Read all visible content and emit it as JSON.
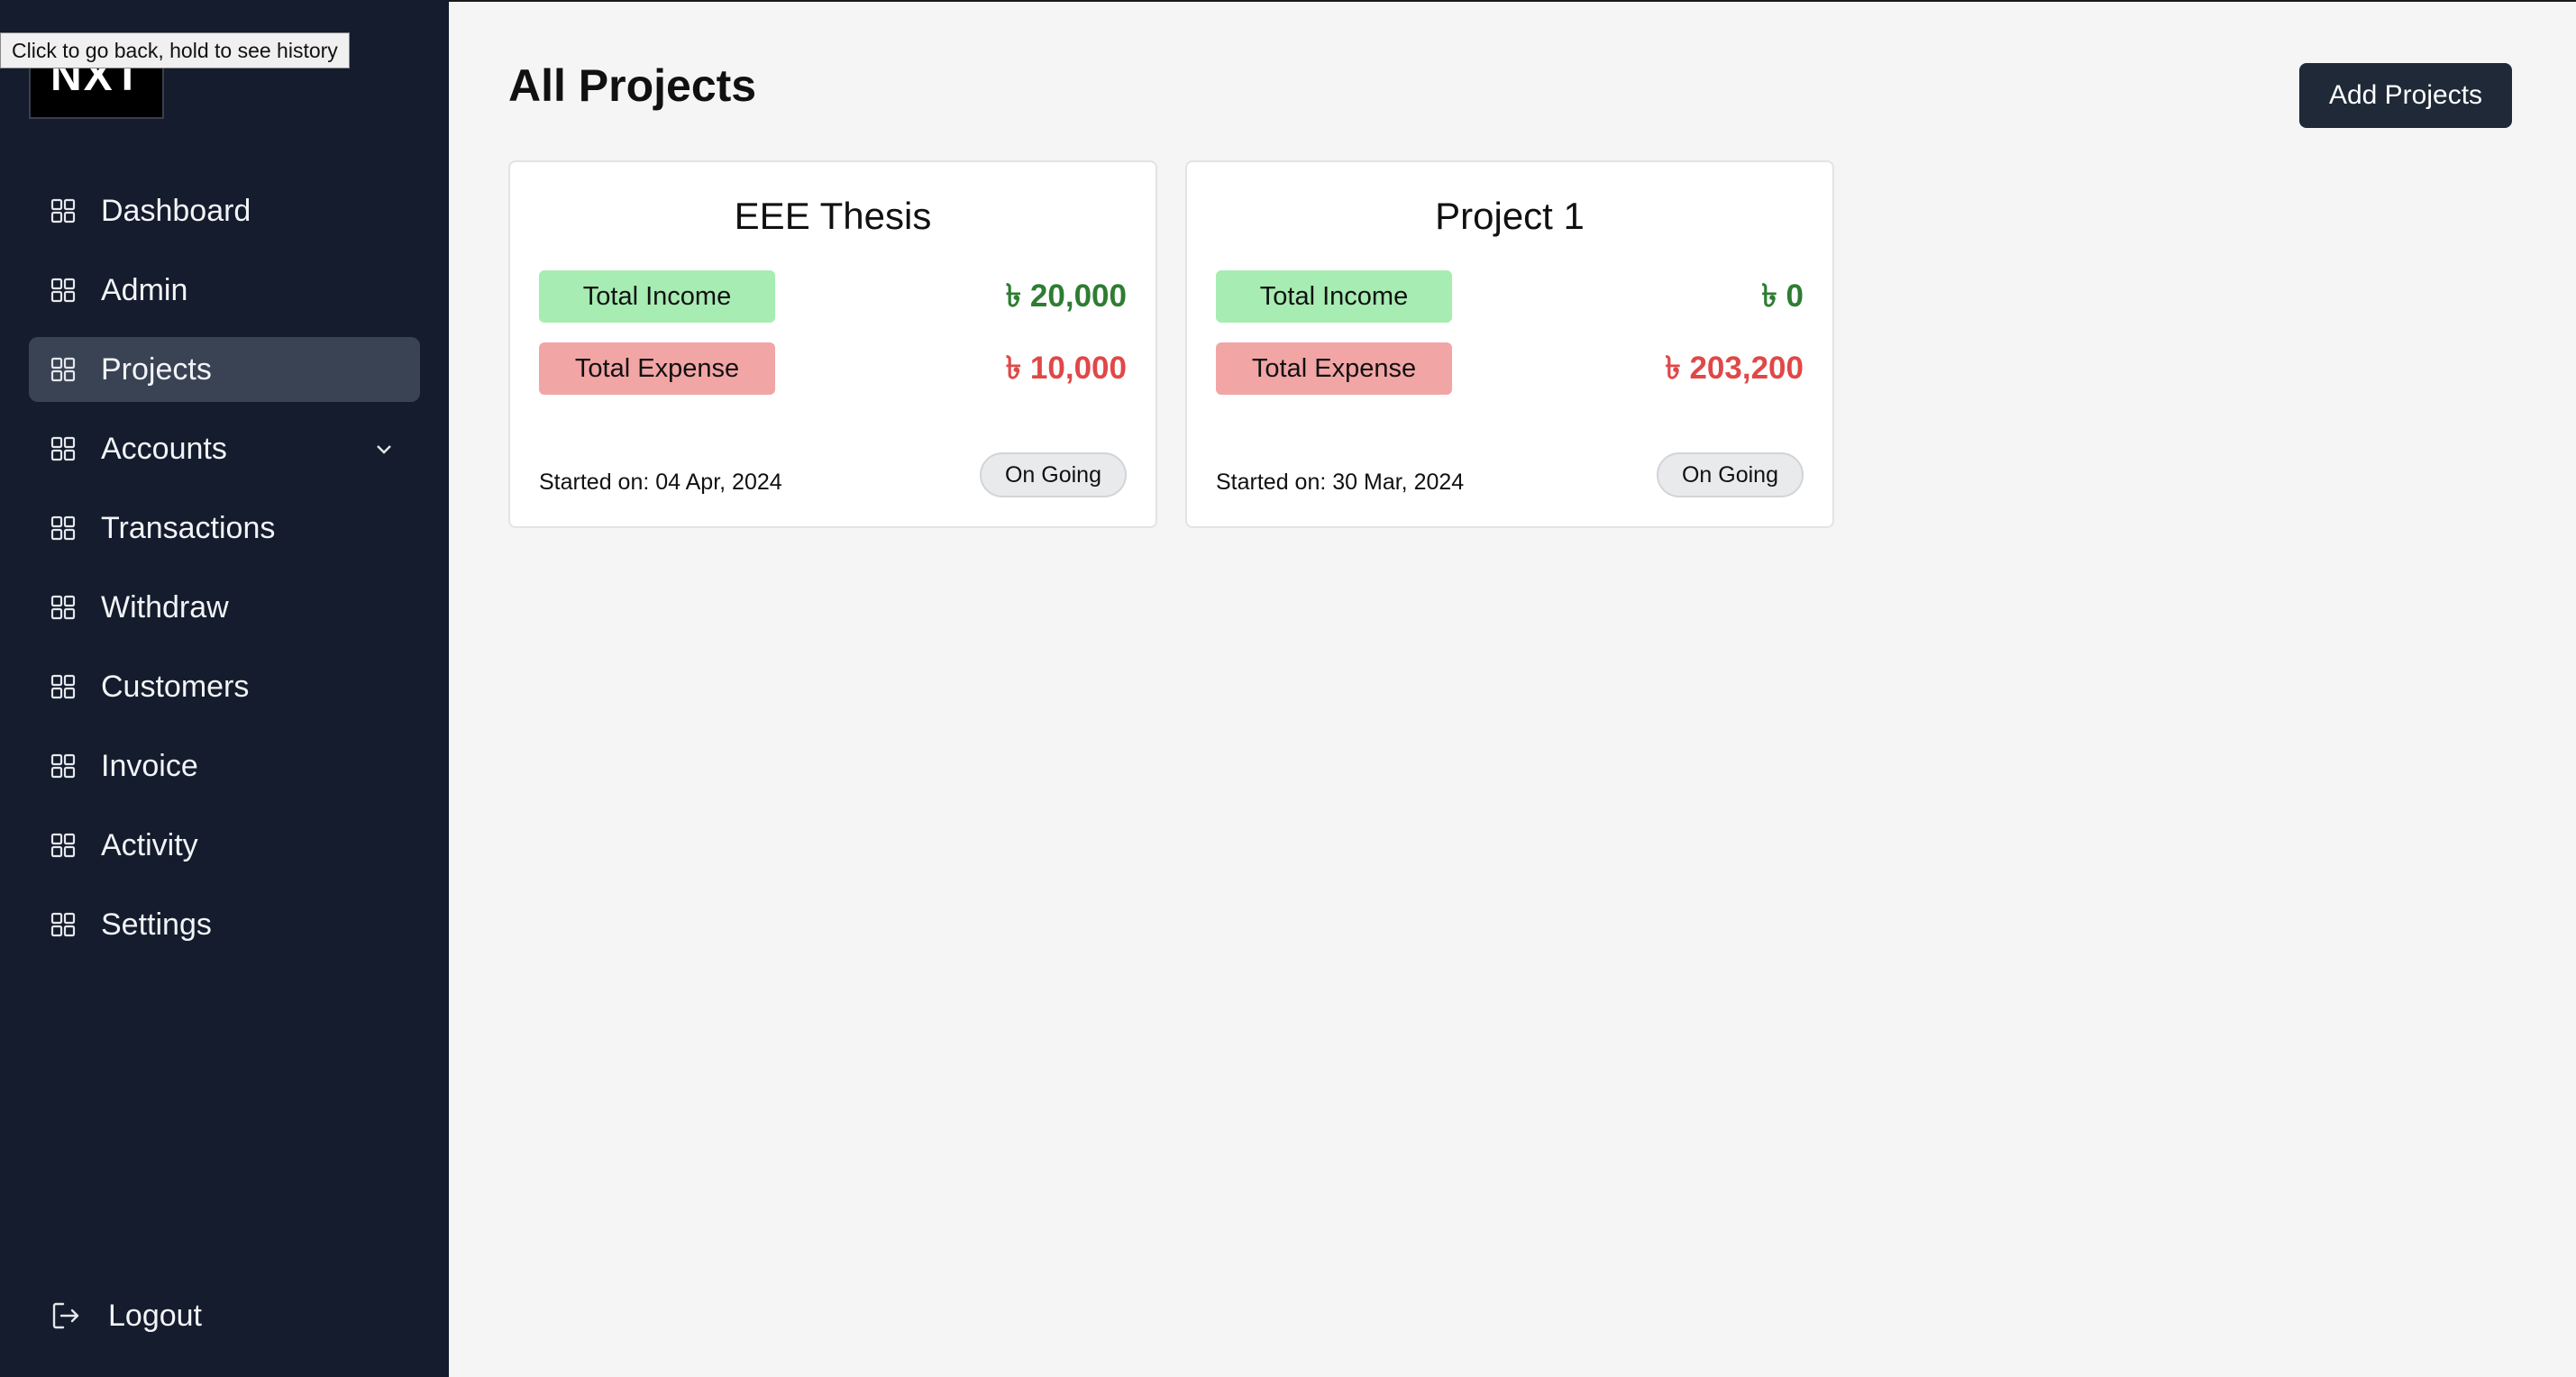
{
  "tooltip": "Click to go back, hold to see history",
  "logo": "NXT",
  "sidebar": {
    "items": [
      {
        "label": "Dashboard"
      },
      {
        "label": "Admin"
      },
      {
        "label": "Projects"
      },
      {
        "label": "Accounts"
      },
      {
        "label": "Transactions"
      },
      {
        "label": "Withdraw"
      },
      {
        "label": "Customers"
      },
      {
        "label": "Invoice"
      },
      {
        "label": "Activity"
      },
      {
        "label": "Settings"
      }
    ],
    "active": "Projects",
    "logout": "Logout"
  },
  "main": {
    "title": "All Projects",
    "add_button": "Add Projects",
    "projects": [
      {
        "name": "EEE Thesis",
        "income_label": "Total Income",
        "income": "৳ 20,000",
        "expense_label": "Total Expense",
        "expense": "৳ 10,000",
        "started": "Started on: 04 Apr, 2024",
        "status": "On Going"
      },
      {
        "name": "Project 1",
        "income_label": "Total Income",
        "income": "৳ 0",
        "expense_label": "Total Expense",
        "expense": "৳ 203,200",
        "started": "Started on: 30 Mar, 2024",
        "status": "On Going"
      }
    ]
  },
  "colors": {
    "sidebar_bg": "#141c2d",
    "active_item_bg": "#3a4354",
    "income_pill": "#a7ecb3",
    "expense_pill": "#f2a5a5",
    "income_text": "#2e7d32",
    "expense_text": "#e04848",
    "button_bg": "#1f2937"
  },
  "icons": {
    "nav_icon": "grid-icon",
    "accounts_chevron": "chevron-down-icon",
    "logout_icon": "logout-icon"
  }
}
